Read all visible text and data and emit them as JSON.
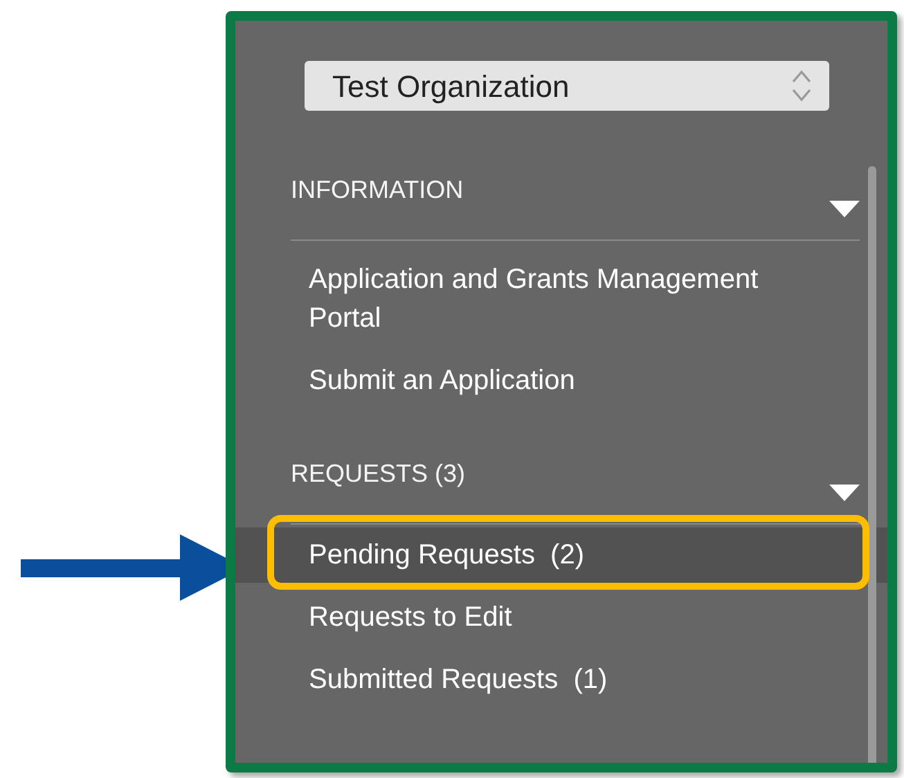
{
  "organization_select": {
    "value": "Test Organization"
  },
  "sections": [
    {
      "title": "INFORMATION",
      "expanded": true,
      "items": [
        {
          "label": "Application and Grants Management Portal",
          "selected": false
        },
        {
          "label": "Submit an Application",
          "selected": false
        }
      ]
    },
    {
      "title": "REQUESTS (3)",
      "expanded": true,
      "items": [
        {
          "label": "Pending Requests  (2)",
          "selected": true
        },
        {
          "label": "Requests to Edit",
          "selected": false
        },
        {
          "label": "Submitted Requests  (1)",
          "selected": false
        }
      ]
    }
  ]
}
